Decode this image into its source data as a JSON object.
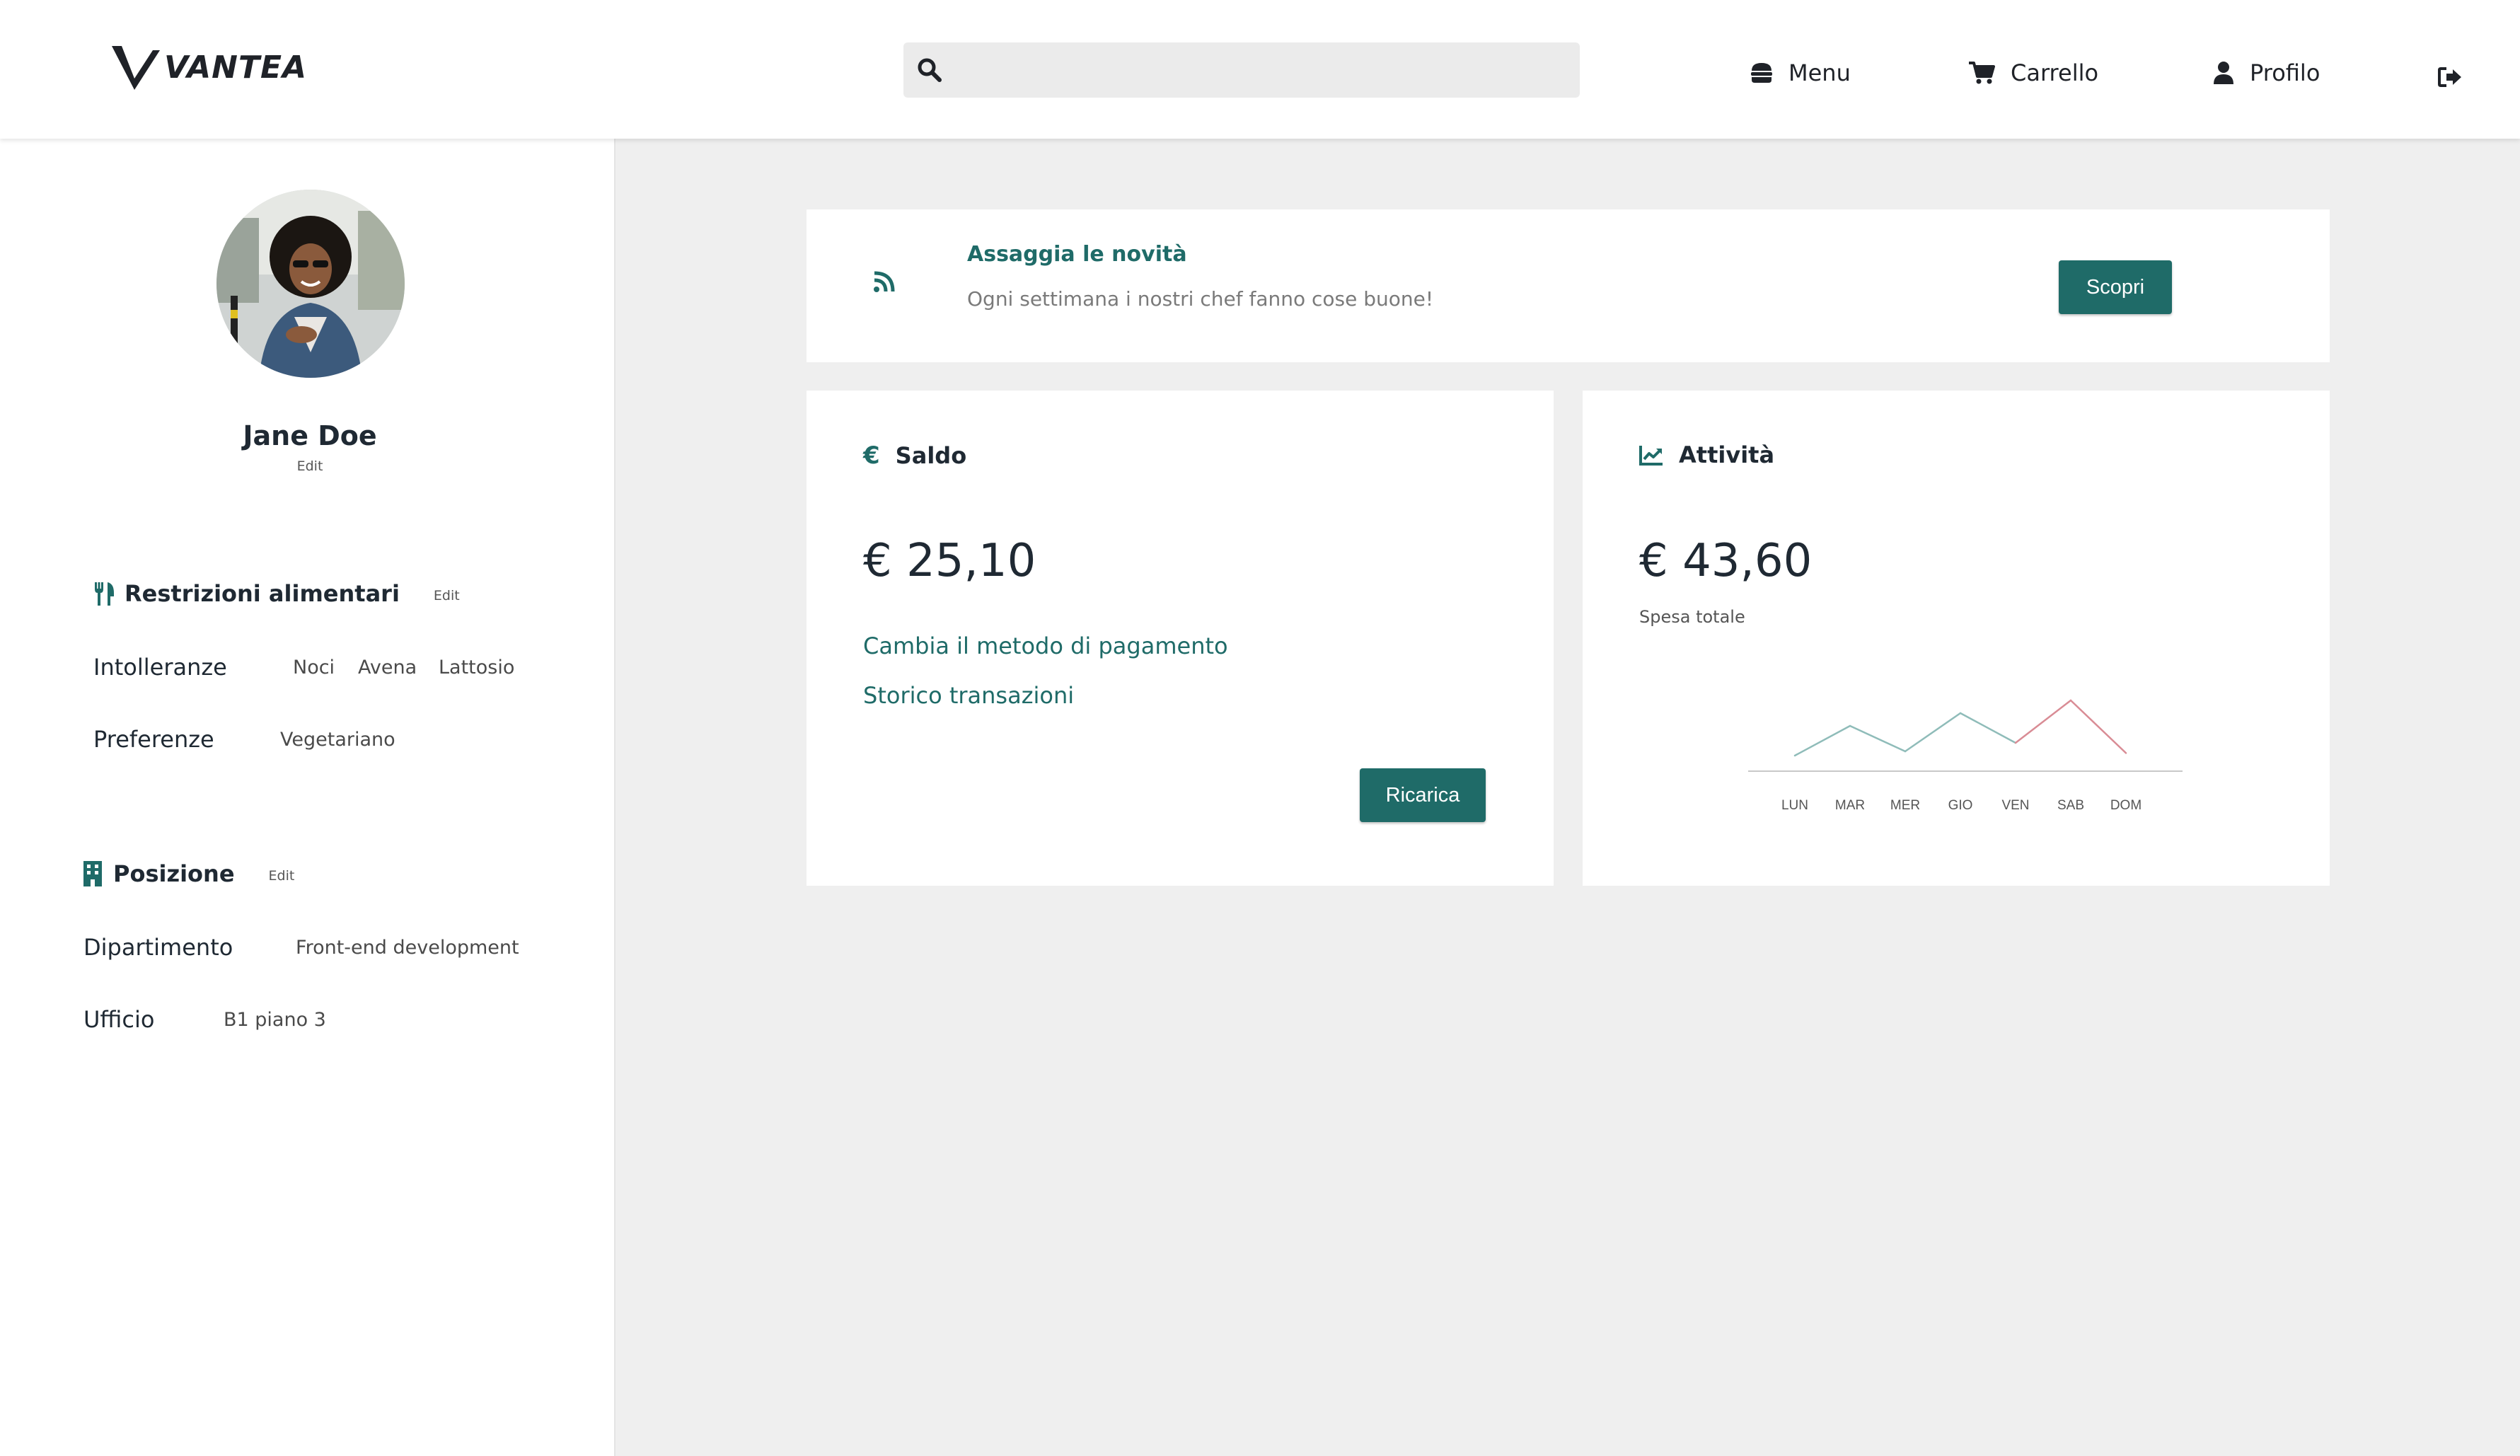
{
  "header": {
    "brand": "VANTEA",
    "search": {
      "placeholder": "",
      "value": ""
    },
    "nav": {
      "menu_label": "Menu",
      "cart_label": "Carrello",
      "profile_label": "Profilo"
    }
  },
  "profile": {
    "name": "Jane Doe",
    "edit_label": "Edit",
    "diet": {
      "title": "Restrizioni alimentari",
      "edit_label": "Edit",
      "intolerances_label": "Intolleranze",
      "intolerances": [
        "Noci",
        "Avena",
        "Lattosio"
      ],
      "preferences_label": "Preferenze",
      "preferences": [
        "Vegetariano"
      ]
    },
    "position": {
      "title": "Posizione",
      "edit_label": "Edit",
      "department_label": "Dipartimento",
      "department": "Front-end development",
      "office_label": "Ufficio",
      "office": "B1 piano 3"
    }
  },
  "promo": {
    "title": "Assaggia le novità",
    "text": "Ogni settimana i nostri chef fanno cose buone!",
    "button_label": "Scopri"
  },
  "balance": {
    "title": "Saldo",
    "currency_symbol": "€",
    "amount": "€ 25,10",
    "change_payment_link": "Cambia il metodo di pagamento",
    "history_link": "Storico transazioni",
    "button_label": "Ricarica"
  },
  "activity": {
    "title": "Attività",
    "amount": "€ 43,60",
    "subtitle": "Spesa totale"
  },
  "chart_data": {
    "type": "line",
    "categories": [
      "LUN",
      "MAR",
      "MER",
      "GIO",
      "VEN",
      "SAB",
      "DOM"
    ],
    "values": [
      2.0,
      5.5,
      2.5,
      7.0,
      3.5,
      8.5,
      2.3
    ],
    "ylim": [
      0,
      10
    ],
    "highlight_index": 5,
    "grid": false,
    "legend": "none",
    "colors": {
      "line": "#8fbcb9",
      "highlight": "#d98c95",
      "axis": "#c8c8c8"
    }
  },
  "colors": {
    "accent": "#1f6b68",
    "background": "#efefef",
    "card": "#ffffff"
  }
}
